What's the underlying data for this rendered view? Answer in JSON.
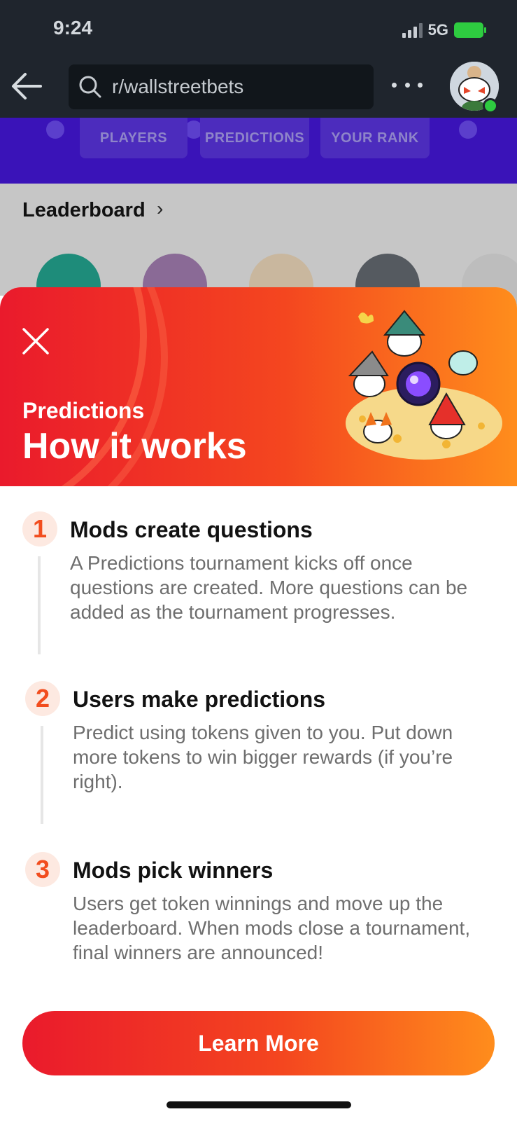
{
  "status_bar": {
    "time": "9:24",
    "network": "5G"
  },
  "nav": {
    "back_icon": "arrow-left-icon",
    "search_icon": "search-icon",
    "search_text": "r/wallstreetbets",
    "more_icon": "more-horizontal-icon"
  },
  "tabs": [
    {
      "label": "PLAYERS"
    },
    {
      "label": "PREDICTIONS"
    },
    {
      "label": "YOUR RANK"
    }
  ],
  "leaderboard": {
    "title": "Leaderboard",
    "chevron": "›"
  },
  "modal": {
    "close_icon": "close-icon",
    "subtitle": "Predictions",
    "title": "How it works",
    "steps": [
      {
        "number": "1",
        "title": "Mods create questions",
        "description": "A Predictions tournament kicks off once questions are created. More questions can be added as the tournament progresses."
      },
      {
        "number": "2",
        "title": "Users make predictions",
        "description": "Predict using tokens given to you. Put down more tokens to win bigger rewards (if you’re right)."
      },
      {
        "number": "3",
        "title": "Mods pick winners",
        "description": "Users get token winnings and move up the leaderboard. When mods close a tournament, final winners are announced!"
      }
    ],
    "button_label": "Learn More"
  },
  "colors": {
    "gradient_start": "#ea1a2c",
    "gradient_end": "#ff8d1c",
    "accent": "#f24d1e",
    "nav_bg": "#1f252d",
    "tab_bg": "#3a13b8"
  }
}
